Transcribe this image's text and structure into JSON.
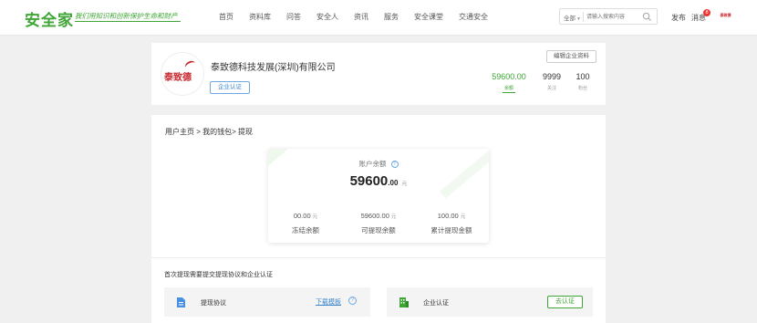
{
  "header": {
    "logo": "安全家",
    "slogan": "我们用知识和创新保护生命和财产",
    "nav": [
      "首页",
      "资料库",
      "问答",
      "安全人",
      "资讯",
      "服务",
      "安全课堂",
      "交通安全"
    ],
    "search": {
      "scope": "全部",
      "placeholder": "请输入搜索内容",
      "icon": "search-icon"
    },
    "publish_label": "发布",
    "message_label": "消息",
    "message_count": "8"
  },
  "company": {
    "logo_text": "泰致德",
    "name": "泰致德科技发展(深圳)有限公司",
    "cert_button": "企业认证",
    "edit_button": "编辑企业资料",
    "stats": {
      "balance": {
        "value": "59600.00",
        "label": "余额"
      },
      "following": {
        "value": "9999",
        "label": "关注"
      },
      "fans": {
        "value": "100",
        "label": "粉丝"
      }
    }
  },
  "breadcrumb": "用户主页 >  我的钱包>  提现",
  "wallet": {
    "title": "账户余额",
    "help": "?",
    "amount_int": "59600",
    "amount_dec": ".00",
    "unit": "元",
    "columns": [
      {
        "value": "00.00",
        "unit": "元",
        "label": "冻结余额"
      },
      {
        "value": "59600.00",
        "unit": "元",
        "label": "可提现余额"
      },
      {
        "value": "100.00",
        "unit": "元",
        "label": "累计提现金额"
      }
    ]
  },
  "withdraw": {
    "notice": "首次提现需要提交提现协议和企业认证",
    "agreement": {
      "title": "提现协议",
      "link": "下载模板",
      "help": "?"
    },
    "certification": {
      "title": "企业认证",
      "button": "去认证"
    }
  },
  "colors": {
    "brand": "#3fa535",
    "link": "#3a86cf",
    "logo_red": "#c7282e"
  }
}
